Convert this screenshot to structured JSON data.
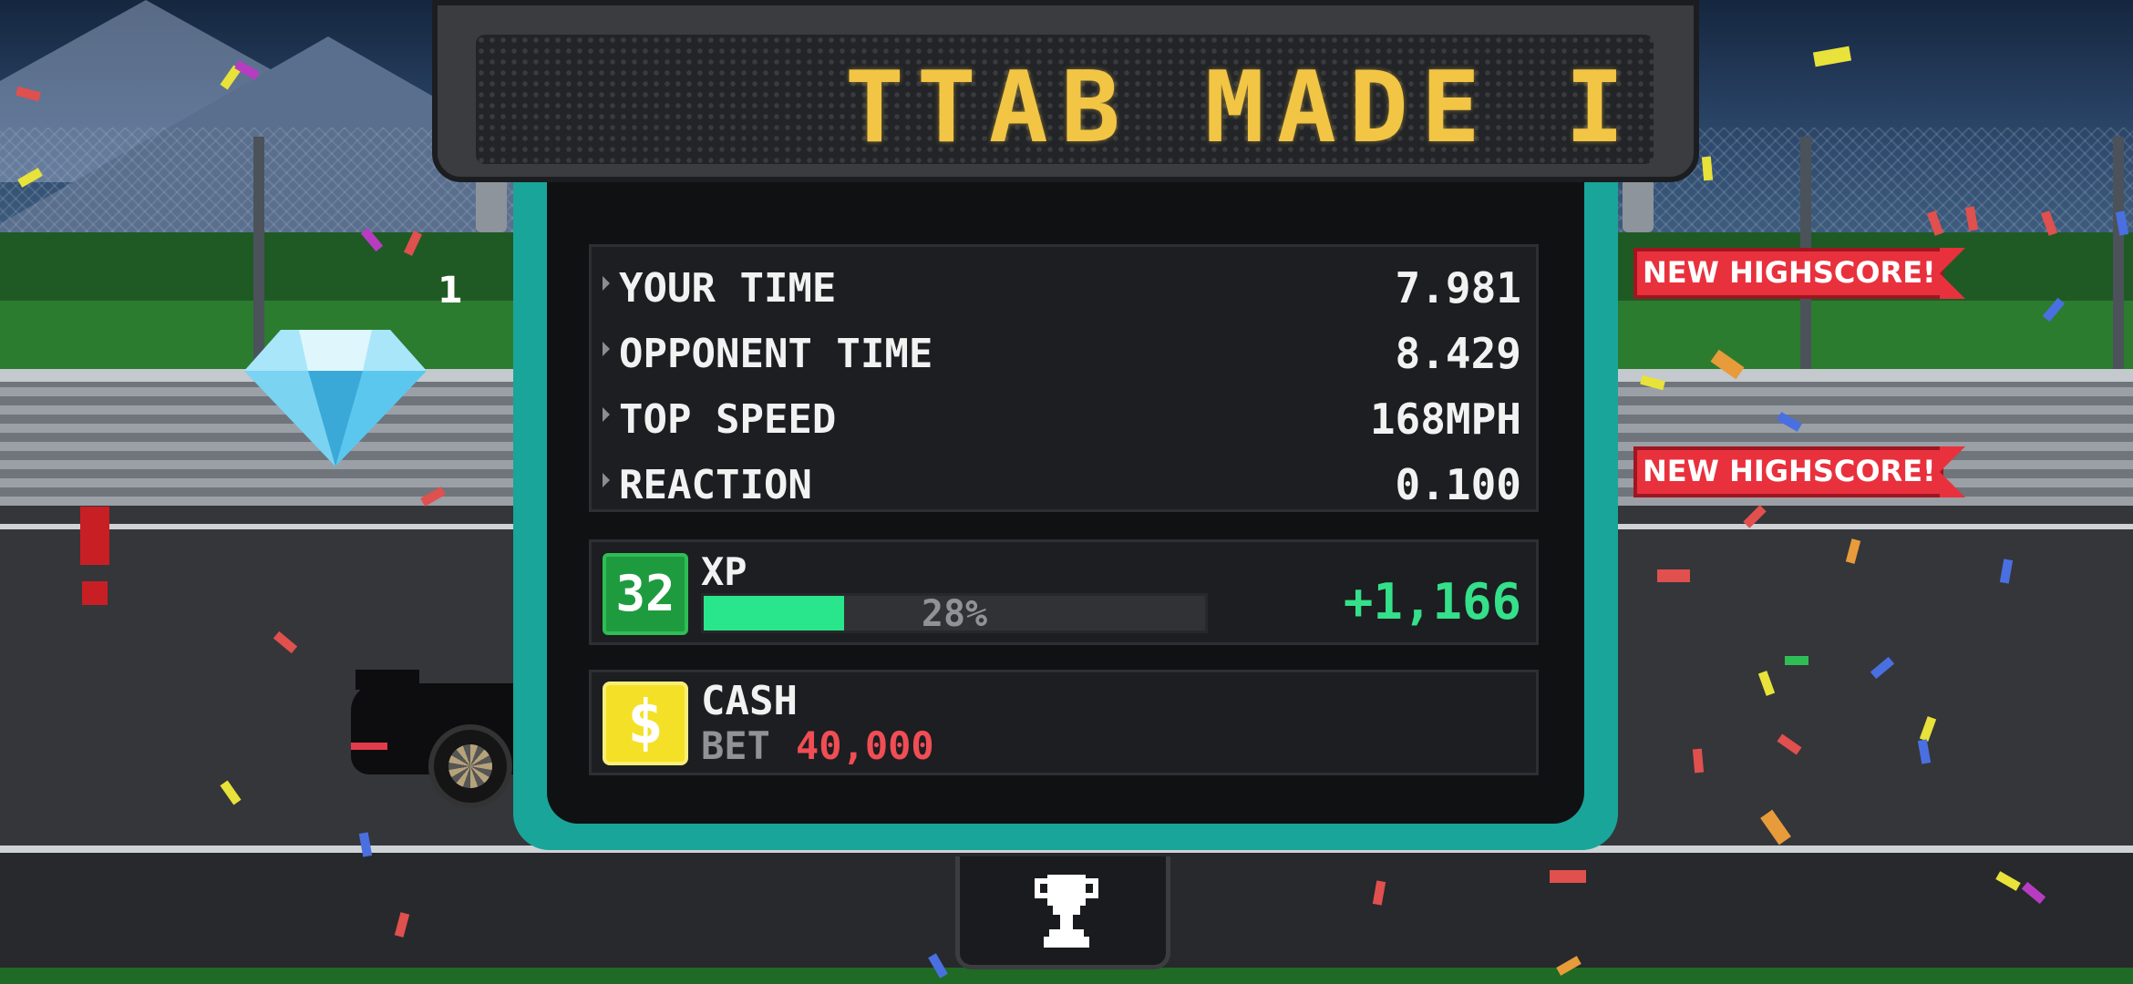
{
  "sign": {
    "text": "TTAB MADE I"
  },
  "gem_count": "1",
  "stats": [
    {
      "label": "YOUR TIME",
      "value": "7.981"
    },
    {
      "label": "OPPONENT TIME",
      "value": "8.429"
    },
    {
      "label": "TOP SPEED",
      "value": "168MPH"
    },
    {
      "label": "REACTION",
      "value": "0.100"
    }
  ],
  "highscores": [
    {
      "text": "NEW HIGHSCORE!",
      "row": "YOUR TIME"
    },
    {
      "text": "NEW HIGHSCORE!",
      "row": "REACTION"
    }
  ],
  "xp": {
    "level": "32",
    "label": "XP",
    "progress": 0.28,
    "progress_text": "28%",
    "gain": "+1,166"
  },
  "cash": {
    "icon": "$",
    "label": "CASH",
    "bet_label": "BET",
    "bet_value": "40,000"
  },
  "icons": {
    "trophy": "trophy-icon",
    "gem": "diamond-icon",
    "cash": "dollar-icon"
  },
  "colors": {
    "panel_border": "#1aa59a",
    "sign_text": "#f2c545",
    "xp_fill": "#29e68d",
    "xp_gain": "#34e08a",
    "bet_value": "#f04d55",
    "ribbon": "#e8313d"
  }
}
